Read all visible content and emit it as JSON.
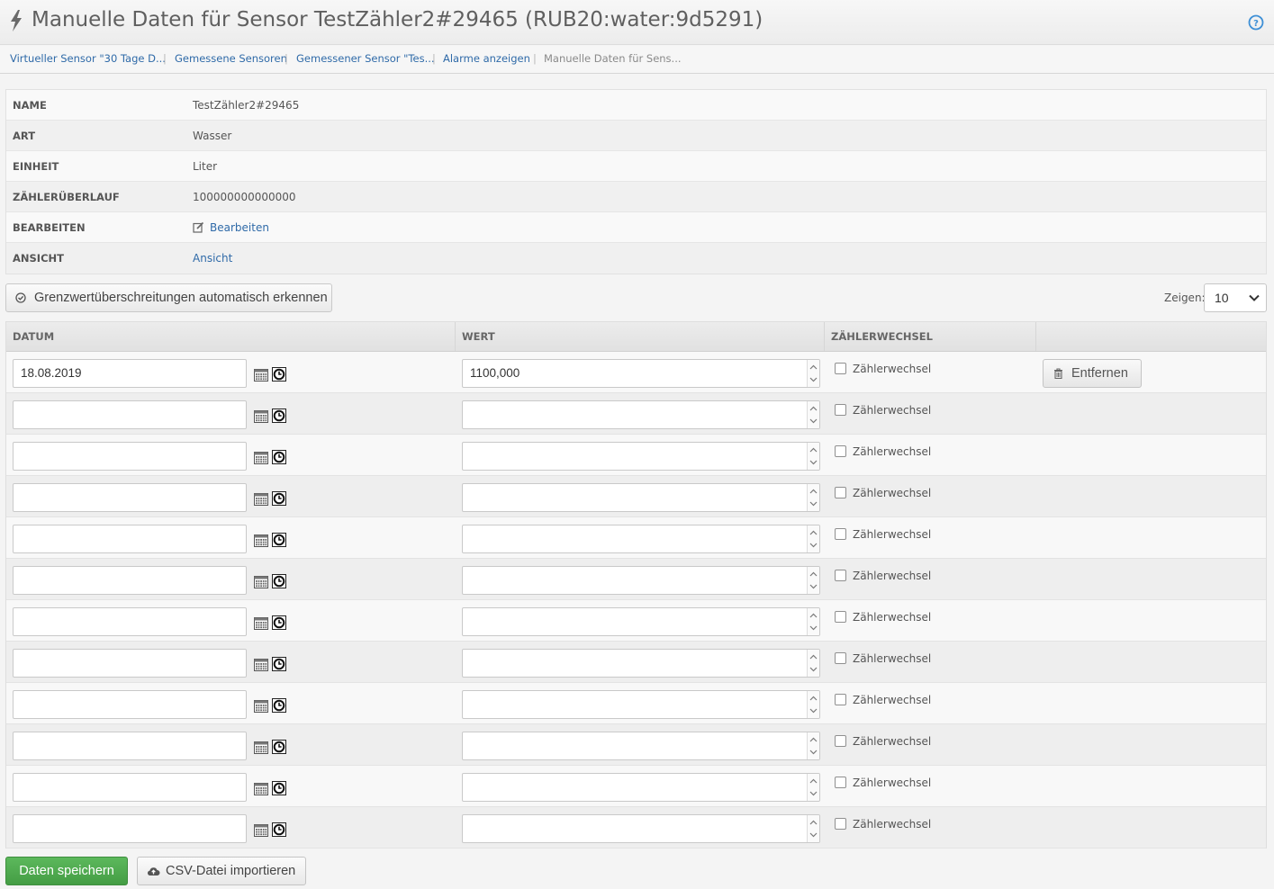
{
  "header": {
    "title": "Manuelle Daten für Sensor TestZähler2#29465 (RUB20:water:9d5291)",
    "icon": "bolt-icon",
    "help_icon": "help-icon"
  },
  "breadcrumb": [
    {
      "label": "Virtueller Sensor \"30 Tage D...",
      "link": true
    },
    {
      "label": "Gemessene Sensoren",
      "link": true
    },
    {
      "label": "Gemessener Sensor \"Tes...",
      "link": true
    },
    {
      "label": "Alarme anzeigen",
      "link": true
    },
    {
      "label": "Manuelle Daten für Sens...",
      "link": false
    }
  ],
  "info": [
    {
      "label": "NAME",
      "value": "TestZähler2#29465"
    },
    {
      "label": "ART",
      "value": "Wasser"
    },
    {
      "label": "EINHEIT",
      "value": "Liter"
    },
    {
      "label": "ZÄHLERÜBERLAUF",
      "value": "100000000000000"
    },
    {
      "label": "BEARBEITEN",
      "value": "Bearbeiten",
      "link": true,
      "icon": "edit-icon"
    },
    {
      "label": "ANSICHT",
      "value": "Ansicht",
      "link": true
    }
  ],
  "toolbar": {
    "auto_detect_label": "Grenzwertüberschreitungen automatisch erkennen",
    "show_label": "Zeigen:",
    "show_value": "10"
  },
  "grid": {
    "columns": [
      "DATUM",
      "WERT",
      "ZÄHLERWECHSEL",
      ""
    ],
    "checkbox_label": "Zählerwechsel",
    "remove_label": "Entfernen",
    "rows": [
      {
        "date": "18.08.2019",
        "value": "1100,000",
        "counter_change": false,
        "removable": true
      },
      {
        "date": "",
        "value": "",
        "counter_change": false,
        "removable": false
      },
      {
        "date": "",
        "value": "",
        "counter_change": false,
        "removable": false
      },
      {
        "date": "",
        "value": "",
        "counter_change": false,
        "removable": false
      },
      {
        "date": "",
        "value": "",
        "counter_change": false,
        "removable": false
      },
      {
        "date": "",
        "value": "",
        "counter_change": false,
        "removable": false
      },
      {
        "date": "",
        "value": "",
        "counter_change": false,
        "removable": false
      },
      {
        "date": "",
        "value": "",
        "counter_change": false,
        "removable": false
      },
      {
        "date": "",
        "value": "",
        "counter_change": false,
        "removable": false
      },
      {
        "date": "",
        "value": "",
        "counter_change": false,
        "removable": false
      },
      {
        "date": "",
        "value": "",
        "counter_change": false,
        "removable": false
      },
      {
        "date": "",
        "value": "",
        "counter_change": false,
        "removable": false
      }
    ]
  },
  "footer": {
    "save_label": "Daten speichern",
    "csv_label": "CSV-Datei importieren"
  },
  "colors": {
    "link": "#2f6aa8",
    "save_button": "#5cb85c"
  }
}
